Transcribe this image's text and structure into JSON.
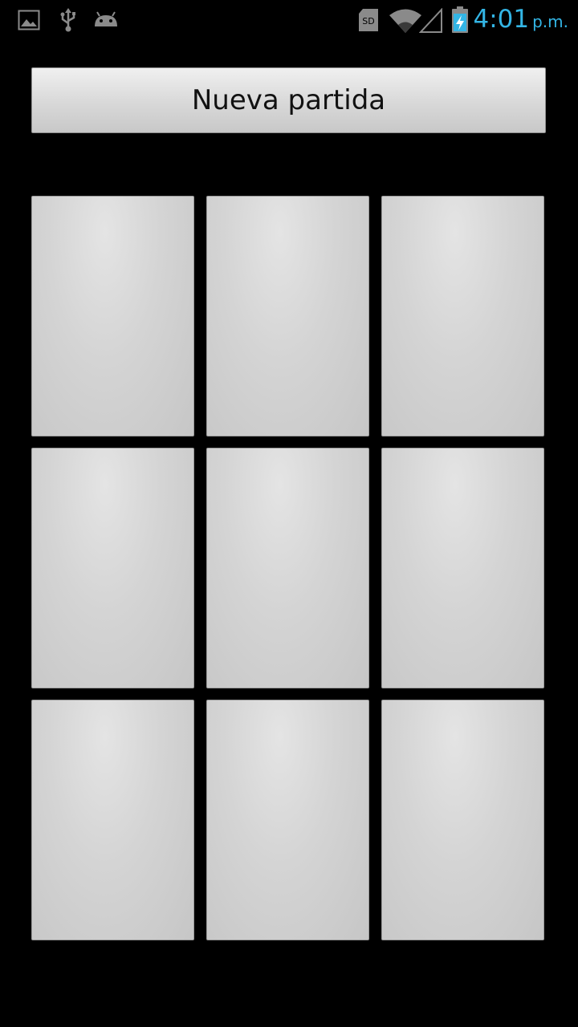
{
  "status_bar": {
    "icons_left": [
      "image-icon",
      "usb-icon",
      "android-debug-icon"
    ],
    "icons_right": [
      "sd-card-icon",
      "wifi-icon",
      "signal-icon",
      "battery-charging-icon"
    ],
    "sd_label": "SD",
    "time": "4:01",
    "ampm": "p.m.",
    "clock_color": "#33b5e5"
  },
  "game": {
    "new_game_label": "Nueva partida",
    "board": [
      "",
      "",
      "",
      "",
      "",
      "",
      "",
      "",
      ""
    ]
  }
}
